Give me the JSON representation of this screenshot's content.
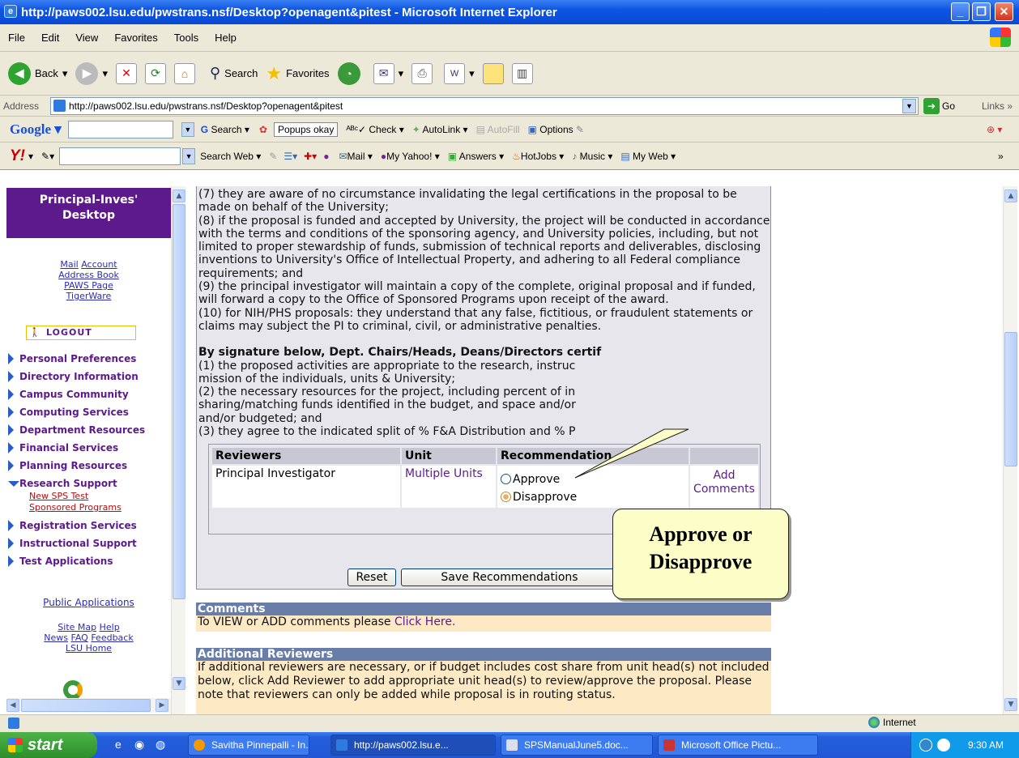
{
  "window": {
    "title": "http://paws002.lsu.edu/pwstrans.nsf/Desktop?openagent&pitest - Microsoft Internet Explorer"
  },
  "menu": [
    "File",
    "Edit",
    "View",
    "Favorites",
    "Tools",
    "Help"
  ],
  "toolbar": {
    "back": "Back",
    "search": "Search",
    "favorites": "Favorites"
  },
  "address": {
    "label": "Address",
    "url": "http://paws002.lsu.edu/pwstrans.nsf/Desktop?openagent&pitest",
    "go": "Go",
    "links": "Links"
  },
  "google": {
    "logo": "Google",
    "search": "Search",
    "popups": "Popups okay",
    "check": "Check",
    "autolink": "AutoLink",
    "autofill": "AutoFill",
    "options": "Options"
  },
  "yahoo": {
    "logo": "Y!",
    "search_web": "Search Web",
    "mail": "Mail",
    "my_yahoo": "My Yahoo!",
    "answers": "Answers",
    "hotjobs": "HotJobs",
    "music": "Music",
    "my_web": "My Web"
  },
  "left": {
    "title_line1": "Principal-Inves'",
    "title_line2": "Desktop",
    "links": {
      "mail": "Mail",
      "account": "Account",
      "address_book": "Address Book",
      "paws_page": "PAWS Page",
      "tigerware": "TigerWare"
    },
    "logout": "LOGOUT",
    "nav": [
      "Personal Preferences",
      "Directory Information",
      "Campus Community",
      "Computing Services",
      "Department Resources",
      "Financial Services",
      "Planning Resources",
      "Research Support",
      "Registration Services",
      "Instructional Support",
      "Test Applications"
    ],
    "sub": [
      "New SPS Test",
      "Sponsored Programs"
    ],
    "public_apps": "Public Applications",
    "footer": {
      "site_map": "Site Map",
      "help": "Help",
      "news": "News",
      "faq": "FAQ",
      "feedback": "Feedback",
      "lsu_home": "LSU Home"
    }
  },
  "main": {
    "p7": "(7) they are aware of no circumstance invalidating the legal certifications in the proposal to be made on behalf of the University;",
    "p8": "(8) if the proposal is funded and accepted by University, the project will be conducted in accordance with the terms and conditions of the sponsoring agency, and University policies, including, but not limited to proper stewardship of funds, submission of technical reports and deliverables, disclosing inventions to University's Office of Intellectual Property, and adhering to all Federal compliance requirements; and",
    "p9": "(9) the principal investigator will maintain a copy of the complete, original proposal and if funded, will forward a copy to the Office of Sponsored Programs upon receipt of the award.",
    "p10": "(10) for NIH/PHS proposals: they understand that any false, fictitious, or fraudulent statements or claims may subject the PI to criminal, civil, or administrative penalties.",
    "sig_head": "By signature below, Dept. Chairs/Heads, Deans/Directors certif",
    "s1": "(1) the proposed activities are appropriate to the research, instruc",
    "s1b": "mission of the individuals, units & University;",
    "s2": "(2) the necessary resources for the project, including percent of in",
    "s2b": "sharing/matching funds identified in the budget, and space and/or",
    "s2c": "and/or budgeted; and",
    "s3": "(3) they agree to the indicated split of % F&A Distribution and % P",
    "table": {
      "headers": [
        "Reviewers",
        "Unit",
        "Recommendation"
      ],
      "reviewer": "Principal Investigator",
      "unit": "Multiple Units",
      "approve": "Approve",
      "disapprove": "Disapprove",
      "add_comments_1": "Add",
      "add_comments_2": "Comments"
    },
    "reset": "Reset",
    "save": "Save Recommendations",
    "comments_head": "Comments",
    "comments_text": "To VIEW or ADD comments please ",
    "comments_link": "Click Here.",
    "addl_head": "Additional Reviewers",
    "addl_text": "If additional reviewers are necessary, or if budget includes cost share from unit head(s) not included below, click Add Reviewer to add appropriate unit head(s) to review/approve the proposal. Please note that reviewers can only be added while proposal is in routing status."
  },
  "callout": {
    "line1": "Approve or",
    "line2": "Disapprove"
  },
  "status": {
    "zone": "Internet"
  },
  "taskbar": {
    "start": "start",
    "tasks": [
      "Savitha Pinnepalli - In...",
      "http://paws002.lsu.e...",
      "SPSManualJune5.doc...",
      "Microsoft Office Pictu..."
    ],
    "clock": "9:30 AM"
  }
}
